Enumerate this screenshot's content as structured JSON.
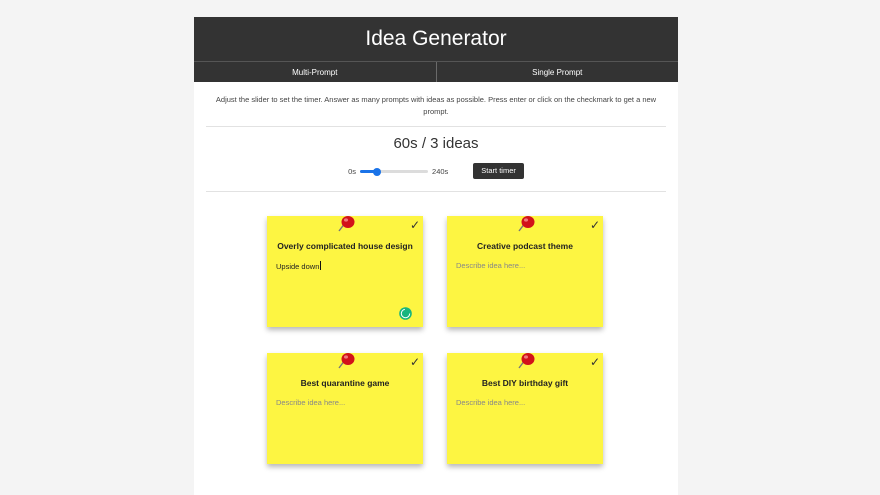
{
  "app": {
    "title": "Idea Generator",
    "tabs": [
      {
        "label": "Multi-Prompt"
      },
      {
        "label": "Single Prompt"
      }
    ],
    "instructions": "Adjust the slider to set the timer. Answer as many prompts with ideas as possible. Press enter or click on the checkmark to get a new prompt."
  },
  "status": {
    "counter": "60s / 3 ideas"
  },
  "timer": {
    "min_label": "0s",
    "max_label": "240s",
    "min_value": 0,
    "max_value": 240,
    "value": 60,
    "start_label": "Start timer"
  },
  "cards": [
    {
      "title": "Overly complicated house design",
      "value": "Upside down",
      "placeholder": "Describe idea here..."
    },
    {
      "title": "Creative podcast theme",
      "value": "",
      "placeholder": "Describe idea here..."
    },
    {
      "title": "Best quarantine game",
      "value": "",
      "placeholder": "Describe idea here..."
    },
    {
      "title": "Best DIY birthday gift",
      "value": "",
      "placeholder": "Describe idea here..."
    }
  ],
  "icons": {
    "pin": "pushpin-icon",
    "check": "checkmark-icon",
    "loading": "loading-spinner-icon"
  },
  "colors": {
    "header_bg": "#333333",
    "note_bg": "#fdf542",
    "slider_accent": "#1a73e8",
    "pin_red": "#d2121a",
    "spinner": "#18b57e"
  }
}
